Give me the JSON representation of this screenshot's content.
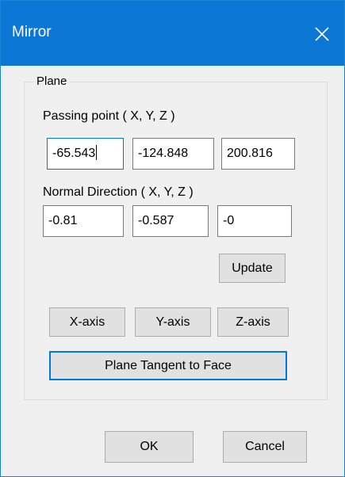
{
  "window": {
    "title": "Mirror"
  },
  "plane_group": {
    "legend": "Plane",
    "passing_point": {
      "label": "Passing point ( X, Y, Z )",
      "x": "-65.543",
      "y": "-124.848",
      "z": "200.816"
    },
    "normal_direction": {
      "label": "Normal Direction ( X, Y, Z )",
      "x": "-0.81",
      "y": "-0.587",
      "z": "-0"
    },
    "update_label": "Update",
    "x_axis_label": "X-axis",
    "y_axis_label": "Y-axis",
    "z_axis_label": "Z-axis",
    "tangent_label": "Plane Tangent to Face"
  },
  "footer": {
    "ok_label": "OK",
    "cancel_label": "Cancel"
  },
  "colors": {
    "titlebar": "#0c77d4",
    "focus_border": "#0078d7",
    "dialog_bg": "#f0f0f0"
  },
  "icons": {
    "close": "close-icon"
  }
}
